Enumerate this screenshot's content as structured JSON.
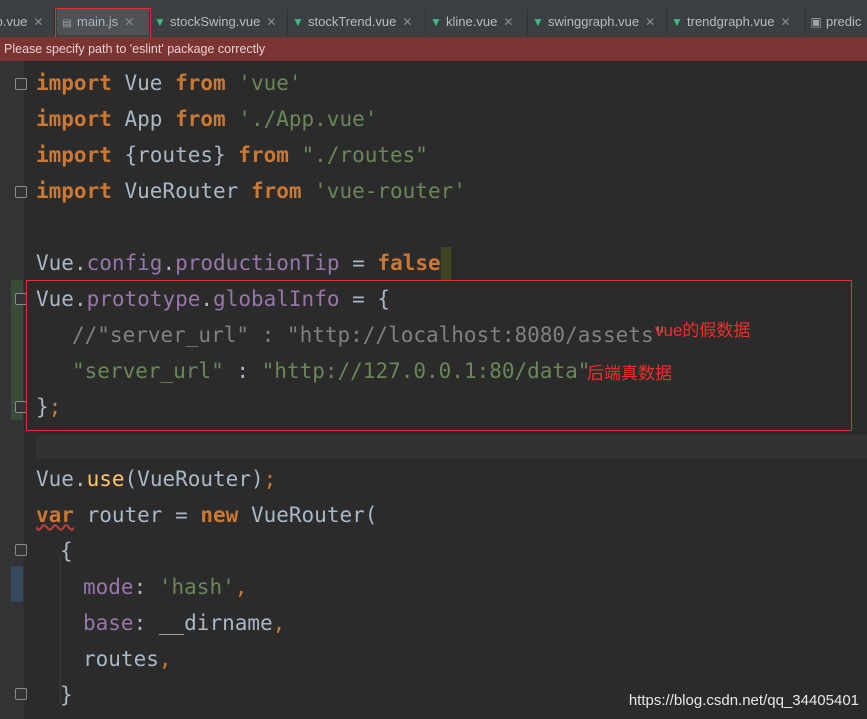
{
  "tabs": [
    {
      "label": "fo.vue",
      "icon": "vue-file-icon",
      "active": false
    },
    {
      "label": "main.js",
      "icon": "js-file-icon",
      "active": true
    },
    {
      "label": "stockSwing.vue",
      "icon": "vue-file-icon",
      "active": false
    },
    {
      "label": "stockTrend.vue",
      "icon": "vue-file-icon",
      "active": false
    },
    {
      "label": "kline.vue",
      "icon": "vue-file-icon",
      "active": false
    },
    {
      "label": "swinggraph.vue",
      "icon": "vue-file-icon",
      "active": false
    },
    {
      "label": "trendgraph.vue",
      "icon": "vue-file-icon",
      "active": false
    },
    {
      "label": "predic",
      "icon": "file-icon",
      "active": false
    }
  ],
  "banner": {
    "text": "Please specify path to 'eslint' package correctly"
  },
  "code": {
    "l1": {
      "kw1": "import",
      "id": " Vue ",
      "kw2": "from",
      "str": " 'vue'"
    },
    "l2": {
      "kw1": "import",
      "id": " App ",
      "kw2": "from",
      "str": " './App.vue'"
    },
    "l3": {
      "kw1": "import",
      "id": " {routes} ",
      "kw2": "from",
      "str": " \"./routes\""
    },
    "l4": {
      "kw1": "import",
      "id": " VueRouter ",
      "kw2": "from",
      "str": " 'vue-router'"
    },
    "l6": {
      "obj": "Vue",
      "dot1": ".",
      "p1": "config",
      "dot2": ".",
      "p2": "productionTip",
      "eq": " = ",
      "val": "false"
    },
    "l7": {
      "obj": "Vue",
      "dot1": ".",
      "p1": "prototype",
      "dot2": ".",
      "p2": "globalInfo",
      "rest": " = {"
    },
    "l8": {
      "comment": "//\"server_url\" : \"http://localhost:8080/assets\""
    },
    "l9": {
      "key": "\"server_url\"",
      "colon": " : ",
      "val": "\"http://127.0.0.1:80/data\""
    },
    "l10": {
      "brace": "}",
      "semi": ";"
    },
    "l12": {
      "obj": "Vue",
      "dot": ".",
      "fn": "use",
      "args": "(VueRouter)",
      "semi": ";"
    },
    "l13": {
      "kw1": "var",
      "id": " router = ",
      "kw2": "new",
      "rest": " VueRouter("
    },
    "l14": {
      "text": "{"
    },
    "l15": {
      "key": "mode",
      "colon": ": ",
      "val": "'hash'",
      "comma": ","
    },
    "l16": {
      "key": "base",
      "colon": ": ",
      "val": "__dirname",
      "comma": ","
    },
    "l17": {
      "val": "routes",
      "comma": ","
    },
    "l18": {
      "text": "}"
    }
  },
  "annotations": {
    "fake_data": "vue的假数据",
    "real_data": "后端真数据"
  },
  "watermark": "https://blog.csdn.net/qq_34405401",
  "colors": {
    "keyword": "#cc7832",
    "string": "#6a8759",
    "property": "#9876aa",
    "annotation": "#ee2d2d",
    "banner_bg": "#7a3432"
  }
}
